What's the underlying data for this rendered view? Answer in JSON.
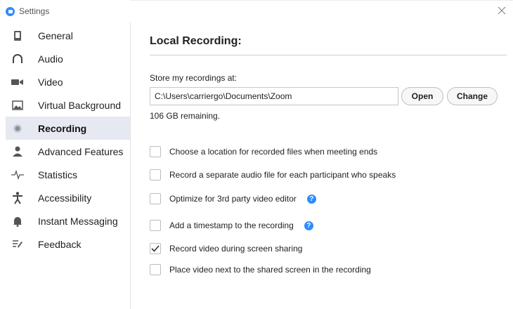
{
  "window": {
    "title": "Settings",
    "accent": "#2d8cff"
  },
  "sidebar": {
    "items": [
      {
        "label": "General",
        "icon": "general-icon"
      },
      {
        "label": "Audio",
        "icon": "headphones-icon"
      },
      {
        "label": "Video",
        "icon": "video-camera-icon"
      },
      {
        "label": "Virtual Background",
        "icon": "image-icon"
      },
      {
        "label": "Recording",
        "icon": "record-icon",
        "active": true
      },
      {
        "label": "Advanced Features",
        "icon": "person-icon"
      },
      {
        "label": "Statistics",
        "icon": "pulse-icon"
      },
      {
        "label": "Accessibility",
        "icon": "accessibility-icon"
      },
      {
        "label": "Instant Messaging",
        "icon": "bell-icon"
      },
      {
        "label": "Feedback",
        "icon": "feedback-icon"
      }
    ]
  },
  "main": {
    "section_title": "Local Recording:",
    "store_label": "Store my recordings at:",
    "path_value": "C:\\Users\\carriergo\\Documents\\Zoom",
    "open_label": "Open",
    "change_label": "Change",
    "remaining": "106 GB remaining.",
    "options": [
      {
        "label": "Choose a location for recorded files when meeting ends",
        "checked": false,
        "help": false
      },
      {
        "label": "Record a separate audio file for each participant who speaks",
        "checked": false,
        "help": false
      },
      {
        "label": "Optimize for 3rd party video editor",
        "checked": false,
        "help": true
      },
      {
        "label": "Add a timestamp to the recording",
        "checked": false,
        "help": true
      },
      {
        "label": "Record video during screen sharing",
        "checked": true,
        "help": false
      },
      {
        "label": "Place video next to the shared screen in the recording",
        "checked": false,
        "help": false
      }
    ],
    "help_glyph": "?"
  }
}
